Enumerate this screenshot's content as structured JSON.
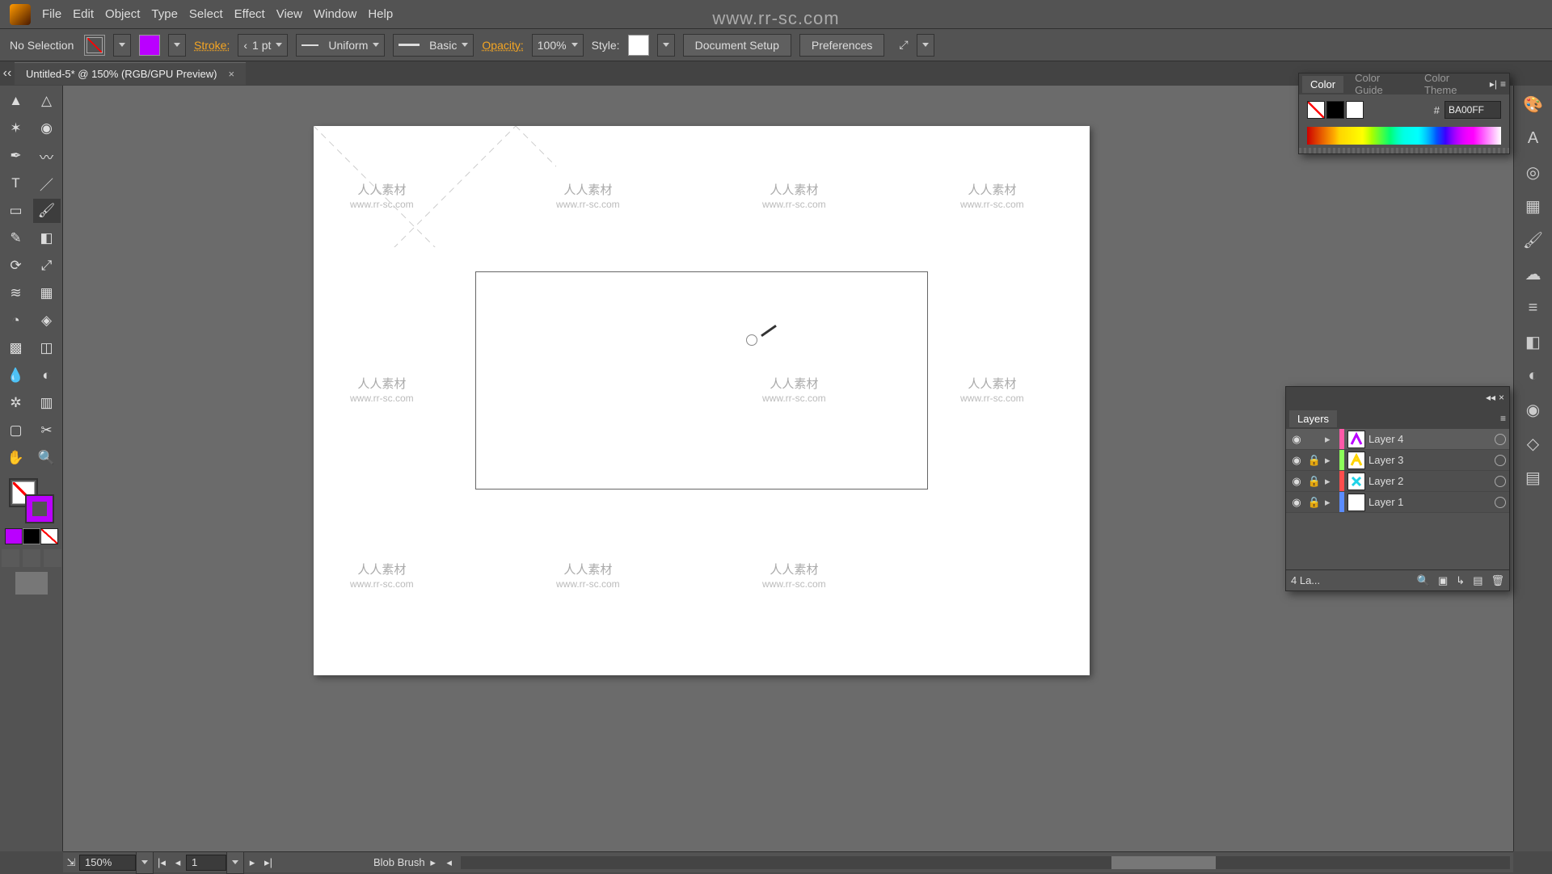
{
  "watermark_url": "www.rr-sc.com",
  "watermark_cn": "人人素材",
  "menu": {
    "items": [
      "File",
      "Edit",
      "Object",
      "Type",
      "Select",
      "Effect",
      "View",
      "Window",
      "Help"
    ]
  },
  "options": {
    "selection": "No Selection",
    "stroke_label": "Stroke:",
    "stroke_weight": "1 pt",
    "brush_profile": "Uniform",
    "brush_def": "Basic",
    "opacity_label": "Opacity:",
    "opacity_value": "100%",
    "style_label": "Style:",
    "doc_setup": "Document Setup",
    "preferences": "Preferences"
  },
  "doc_tab": {
    "title": "Untitled-5* @ 150% (RGB/GPU Preview)",
    "close": "×"
  },
  "color_panel": {
    "tabs": [
      "Color",
      "Color Guide",
      "Color Theme"
    ],
    "hex_label": "#",
    "hex_value": "BA00FF"
  },
  "layers_panel": {
    "title": "Layers",
    "rows": [
      {
        "name": "Layer 4",
        "locked": false,
        "color": "#ff5aa8",
        "thumb": "#BA00FF",
        "sel": true
      },
      {
        "name": "Layer 3",
        "locked": true,
        "color": "#8cff5a",
        "thumb": "#ffd400",
        "sel": false
      },
      {
        "name": "Layer 2",
        "locked": true,
        "color": "#ff4d4d",
        "thumb": "#00d4ff",
        "sel": false
      },
      {
        "name": "Layer 1",
        "locked": true,
        "color": "#5a8cff",
        "thumb": "#ffffff",
        "sel": false
      }
    ],
    "footer": "4 La..."
  },
  "status": {
    "zoom": "150%",
    "artboard": "1",
    "tool": "Blob Brush"
  },
  "colors": {
    "stroke": "#BA00FF",
    "fill": "none",
    "canvas_bg": "#6b6b6b",
    "panel_bg": "#535353"
  }
}
